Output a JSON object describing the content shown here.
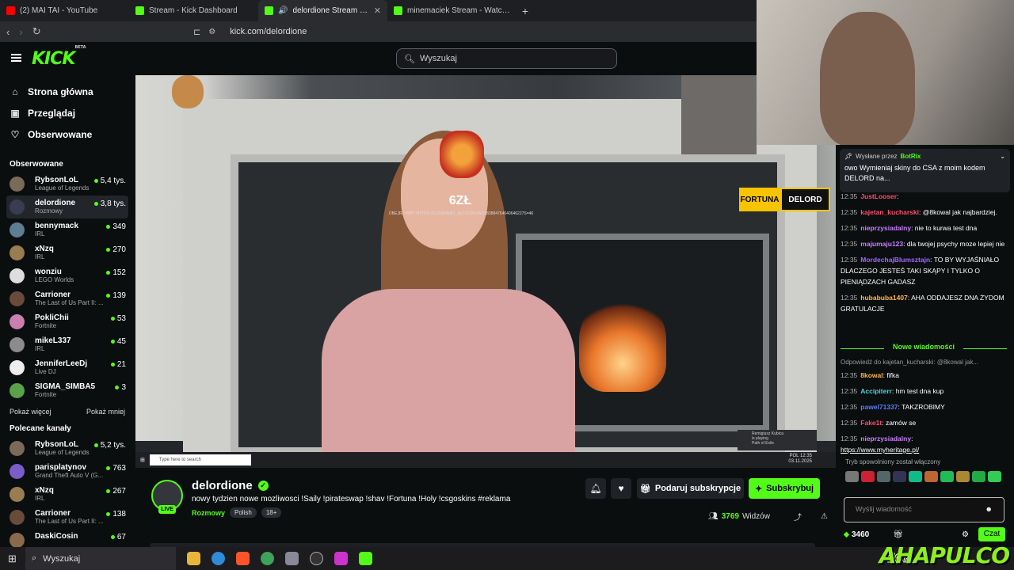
{
  "browser": {
    "tabs": [
      {
        "title": "(2) MAI TAI - YouTube",
        "color": "#ff0000"
      },
      {
        "title": "Stream - Kick Dashboard",
        "color": "#53fc18"
      },
      {
        "title": "delordione Stream - Watch Li",
        "color": "#53fc18",
        "active": true
      },
      {
        "title": "minemaciek Stream - Watch Live on",
        "color": "#53fc18"
      }
    ],
    "url": "kick.com/delordione"
  },
  "header": {
    "logo": "KICK",
    "logo_beta": "BETA",
    "search_placeholder": "Wyszukaj"
  },
  "sidebar": {
    "nav": [
      {
        "label": "Strona główna",
        "icon": "⌂"
      },
      {
        "label": "Przeglądaj",
        "icon": "▣"
      },
      {
        "label": "Obserwowane",
        "icon": "♡"
      }
    ],
    "followed_title": "Obserwowane",
    "followed": [
      {
        "name": "RybsonLoL",
        "game": "League of Legends",
        "viewers": "5,4 tys.",
        "color": "#7c6a58"
      },
      {
        "name": "delordione",
        "game": "Rozmowy",
        "viewers": "3,8 tys.",
        "color": "#3a3d52"
      },
      {
        "name": "bennymack",
        "game": "IRL",
        "viewers": "349",
        "color": "#5e7c92"
      },
      {
        "name": "xNzq",
        "game": "IRL",
        "viewers": "270",
        "color": "#9a7c52"
      },
      {
        "name": "wonziu",
        "game": "LEGO Worlds",
        "viewers": "152",
        "color": "#dddddd"
      },
      {
        "name": "Carrioner",
        "game": "The Last of Us Part II: ...",
        "viewers": "139",
        "color": "#6a4a3a"
      },
      {
        "name": "PokliChii",
        "game": "Fortnite",
        "viewers": "53",
        "color": "#c97fb0"
      },
      {
        "name": "mikeL337",
        "game": "IRL",
        "viewers": "45",
        "color": "#8b8b8b"
      },
      {
        "name": "JenniferLeeDj",
        "game": "Live DJ",
        "viewers": "21",
        "color": "#eeeeee"
      },
      {
        "name": "SIGMA_SIMBA5",
        "game": "Fortnite",
        "viewers": "3",
        "color": "#5aa14b"
      }
    ],
    "show_more": "Pokaż więcej",
    "show_less": "Pokaż mniej",
    "recommended_title": "Polecane kanały",
    "recommended": [
      {
        "name": "RybsonLoL",
        "game": "League of Legends",
        "viewers": "5,2 tys.",
        "color": "#7c6a58"
      },
      {
        "name": "parisplatynov",
        "game": "Grand Theft Auto V (G...",
        "viewers": "763",
        "color": "#7b5cc9"
      },
      {
        "name": "xNzq",
        "game": "IRL",
        "viewers": "267",
        "color": "#9a7c52"
      },
      {
        "name": "Carrioner",
        "game": "The Last of Us Part II: ...",
        "viewers": "138",
        "color": "#6a4a3a"
      },
      {
        "name": "DaskiCosin",
        "game": "",
        "viewers": "67",
        "color": "#8a6a4a"
      }
    ]
  },
  "player": {
    "overlay_amount": "6ZŁ",
    "overlay_url": "OBEJRZYMY? HTTPS://X.COM/NIKT_ALT/STATUS/1983884764640646227S=46",
    "fortuna_left": "FORTUNA",
    "fortuna_right": "DELORD",
    "taskbar_search": "Type here to search",
    "taskbar_clock": "12:35",
    "taskbar_date": "03.11.2025",
    "taskbar_lang": "POL",
    "remote_name": "Remigiusz Kubica",
    "remote_status": "is playing",
    "remote_game": "Path of Exile"
  },
  "channel": {
    "name": "delordione",
    "live": "LIVE",
    "title": "nowy tydzien nowe mozliwosci !Saily !pirateswap !shav !Fortuna !Holy !csgoskins  #reklama",
    "category": "Rozmowy",
    "tags": [
      "Polish",
      "18+"
    ],
    "gift_label": "Podaruj subskrypcje",
    "subscribe_label": "Subskrybuj",
    "viewers": "3769",
    "viewers_label": "Widzów"
  },
  "chat": {
    "pinned_by": "Wysłane przez",
    "pinned_user": "BotRix",
    "pinned_text": "owo Wymieniaj skiny do CSA z moim kodem DELORD na...",
    "messages": [
      {
        "time": "12:35",
        "user": "JustLooser",
        "color": "#ff4d6d",
        "text": ""
      },
      {
        "time": "12:35",
        "user": "kajetan_kucharski",
        "color": "#ff4d6d",
        "text": "@8kowal jak najbardziej."
      },
      {
        "time": "12:35",
        "user": "nieprzysiadalny",
        "color": "#c77dff",
        "text": "nie to kurwa test dna"
      },
      {
        "time": "12:35",
        "user": "majumaju123",
        "color": "#c77dff",
        "text": "dla twojej psychy moze lepiej nie"
      },
      {
        "time": "12:35",
        "user": "MordechajBlumsztajn",
        "color": "#a066ff",
        "text": "TO BY WYJAŚNIAŁO DLACZEGO JESTEŚ TAKI SKĄPY I TYLKO O PIENIĄDZACH GADASZ"
      },
      {
        "time": "12:35",
        "user": "hubabuba1407",
        "color": "#ffb74d",
        "text": "AHA ODDAJESZ DNA ŻYDOM GRATULACJE"
      }
    ],
    "new_messages": "Nowe wiadomości",
    "reply_hint": "Odpowiedź do kajetan_kucharski: @8kowal jak...",
    "messages2": [
      {
        "time": "12:35",
        "user": "8kowal",
        "color": "#ffb74d",
        "text": "fifka"
      },
      {
        "time": "12:35",
        "user": "Accipiterr",
        "color": "#4dd0e1",
        "text": "hm test dna kup"
      },
      {
        "time": "12:35",
        "user": "pawel71337",
        "color": "#5c7cff",
        "text": "TAKZROBIMY"
      },
      {
        "time": "12:35",
        "user": "Fake1t",
        "color": "#ff4d6d",
        "text": "zamów se"
      },
      {
        "time": "12:35",
        "user": "nieprzysiadalny",
        "color": "#c77dff",
        "text": ""
      }
    ],
    "link": "https://www.myheritage.pl/",
    "slow_mode": "Tryb spowolniony został włączony",
    "input_placeholder": "Wyślij wiadomość",
    "points": "3460",
    "send_label": "Czat"
  },
  "windows": {
    "search": "Wyszukaj",
    "watermark": "AHAPULCO",
    "kick_small": "KICK"
  }
}
